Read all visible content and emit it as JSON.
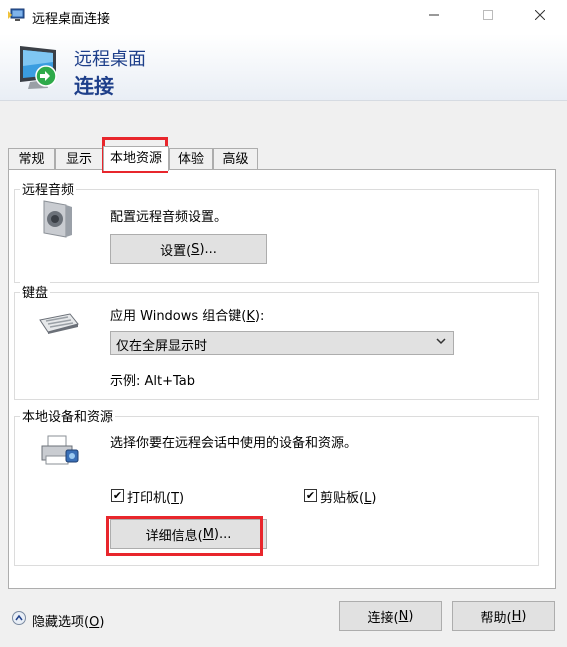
{
  "window": {
    "title": "远程桌面连接",
    "minimize_icon": "minimize-icon",
    "maximize_icon": "maximize-icon",
    "close_icon": "close-icon"
  },
  "header": {
    "line1": "远程桌面",
    "line2": "连接"
  },
  "tabs": [
    {
      "label": "常规"
    },
    {
      "label": "显示"
    },
    {
      "label": "本地资源",
      "active": true
    },
    {
      "label": "体验"
    },
    {
      "label": "高级"
    }
  ],
  "audio": {
    "group_title": "远程音频",
    "description": "配置远程音频设置。",
    "button_prefix": "设置(",
    "button_key": "S",
    "button_suffix": ")..."
  },
  "keyboard": {
    "group_title": "键盘",
    "label_prefix": "应用 Windows 组合键(",
    "label_key": "K",
    "label_suffix": "):",
    "selected": "仅在全屏显示时",
    "example": "示例: Alt+Tab"
  },
  "devices": {
    "group_title": "本地设备和资源",
    "description": "选择你要在远程会话中使用的设备和资源。",
    "printer_prefix": "打印机(",
    "printer_key": "T",
    "printer_suffix": ")",
    "printer_checked": true,
    "clipboard_prefix": "剪贴板(",
    "clipboard_key": "L",
    "clipboard_suffix": ")",
    "clipboard_checked": true,
    "more_prefix": "详细信息(",
    "more_key": "M",
    "more_suffix": ")..."
  },
  "footer": {
    "hide_prefix": "隐藏选项(",
    "hide_key": "O",
    "hide_suffix": ")",
    "connect_prefix": "连接(",
    "connect_key": "N",
    "connect_suffix": ")",
    "help_prefix": "帮助(",
    "help_key": "H",
    "help_suffix": ")"
  },
  "colors": {
    "highlight": "#e8262c",
    "header_text": "#1e3f8a"
  },
  "checkmark": "✔"
}
